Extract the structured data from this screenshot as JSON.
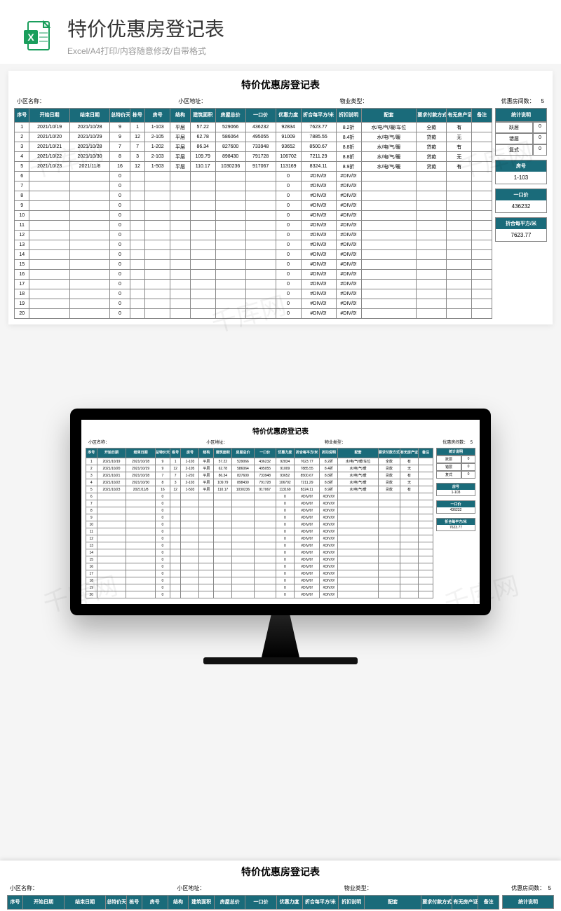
{
  "header": {
    "title": "特价优惠房登记表",
    "subtitle": "Excel/A4打印/内容随意修改/自带格式"
  },
  "sheet": {
    "title": "特价优惠房登记表",
    "meta": {
      "community_name_label": "小区名称：",
      "community_addr_label": "小区地址：",
      "property_type_label": "物业类型：",
      "discount_count_label": "优惠房间数：",
      "discount_count_value": "5"
    },
    "columns": [
      "序号",
      "开始日期",
      "结束日期",
      "总特价天数",
      "栋号",
      "房号",
      "结构",
      "建筑面积",
      "房屋总价",
      "一口价",
      "优惠力度",
      "折合每平方/米",
      "折扣说明",
      "配套",
      "要求付款方式",
      "有无房产证",
      "备注"
    ],
    "rows": [
      {
        "seq": 1,
        "start": "2021/10/19",
        "end": "2021/10/28",
        "days": 9,
        "bldg": 1,
        "room": "1-103",
        "struct": "平层",
        "area": "57.22",
        "total": "529066",
        "price": "436232",
        "disc": "92834",
        "persqm": "7623.77",
        "discnote": "8.2折",
        "amen": "水/电/气/暖/车位",
        "pay": "全款",
        "cert": "有",
        "remark": ""
      },
      {
        "seq": 2,
        "start": "2021/10/20",
        "end": "2021/10/29",
        "days": 9,
        "bldg": 12,
        "room": "2-105",
        "struct": "平层",
        "area": "62.78",
        "total": "586064",
        "price": "495055",
        "disc": "91009",
        "persqm": "7885.55",
        "discnote": "8.4折",
        "amen": "水/电/气/暖",
        "pay": "贷款",
        "cert": "无",
        "remark": ""
      },
      {
        "seq": 3,
        "start": "2021/10/21",
        "end": "2021/10/28",
        "days": 7,
        "bldg": 7,
        "room": "1-202",
        "struct": "平层",
        "area": "86.34",
        "total": "827600",
        "price": "733948",
        "disc": "93652",
        "persqm": "8500.67",
        "discnote": "8.8折",
        "amen": "水/电/气/暖",
        "pay": "贷款",
        "cert": "有",
        "remark": ""
      },
      {
        "seq": 4,
        "start": "2021/10/22",
        "end": "2021/10/30",
        "days": 8,
        "bldg": 3,
        "room": "2-103",
        "struct": "平层",
        "area": "109.79",
        "total": "898430",
        "price": "791728",
        "disc": "106702",
        "persqm": "7211.29",
        "discnote": "8.8折",
        "amen": "水/电/气/暖",
        "pay": "贷款",
        "cert": "无",
        "remark": ""
      },
      {
        "seq": 5,
        "start": "2021/10/23",
        "end": "2021/11/8",
        "days": 16,
        "bldg": 12,
        "room": "1-503",
        "struct": "平层",
        "area": "110.17",
        "total": "1030236",
        "price": "917067",
        "disc": "113169",
        "persqm": "8324.11",
        "discnote": "8.9折",
        "amen": "水/电/气/暖",
        "pay": "贷款",
        "cert": "有",
        "remark": ""
      }
    ],
    "empty_row": {
      "days": "0",
      "disc": "0",
      "persqm": "#DIV/0!",
      "discnote": "#DIV/0!"
    },
    "empty_count": 15,
    "stats": {
      "header": "统计说明",
      "items": [
        {
          "label": "跃层",
          "value": "0"
        },
        {
          "label": "错层",
          "value": "0"
        },
        {
          "label": "复式",
          "value": "0"
        }
      ],
      "boxes": [
        {
          "label": "房号",
          "value": "1-103"
        },
        {
          "label": "一口价",
          "value": "436232"
        },
        {
          "label": "折合每平方/米",
          "value": "7623.77"
        }
      ]
    }
  },
  "watermark": "千库网"
}
